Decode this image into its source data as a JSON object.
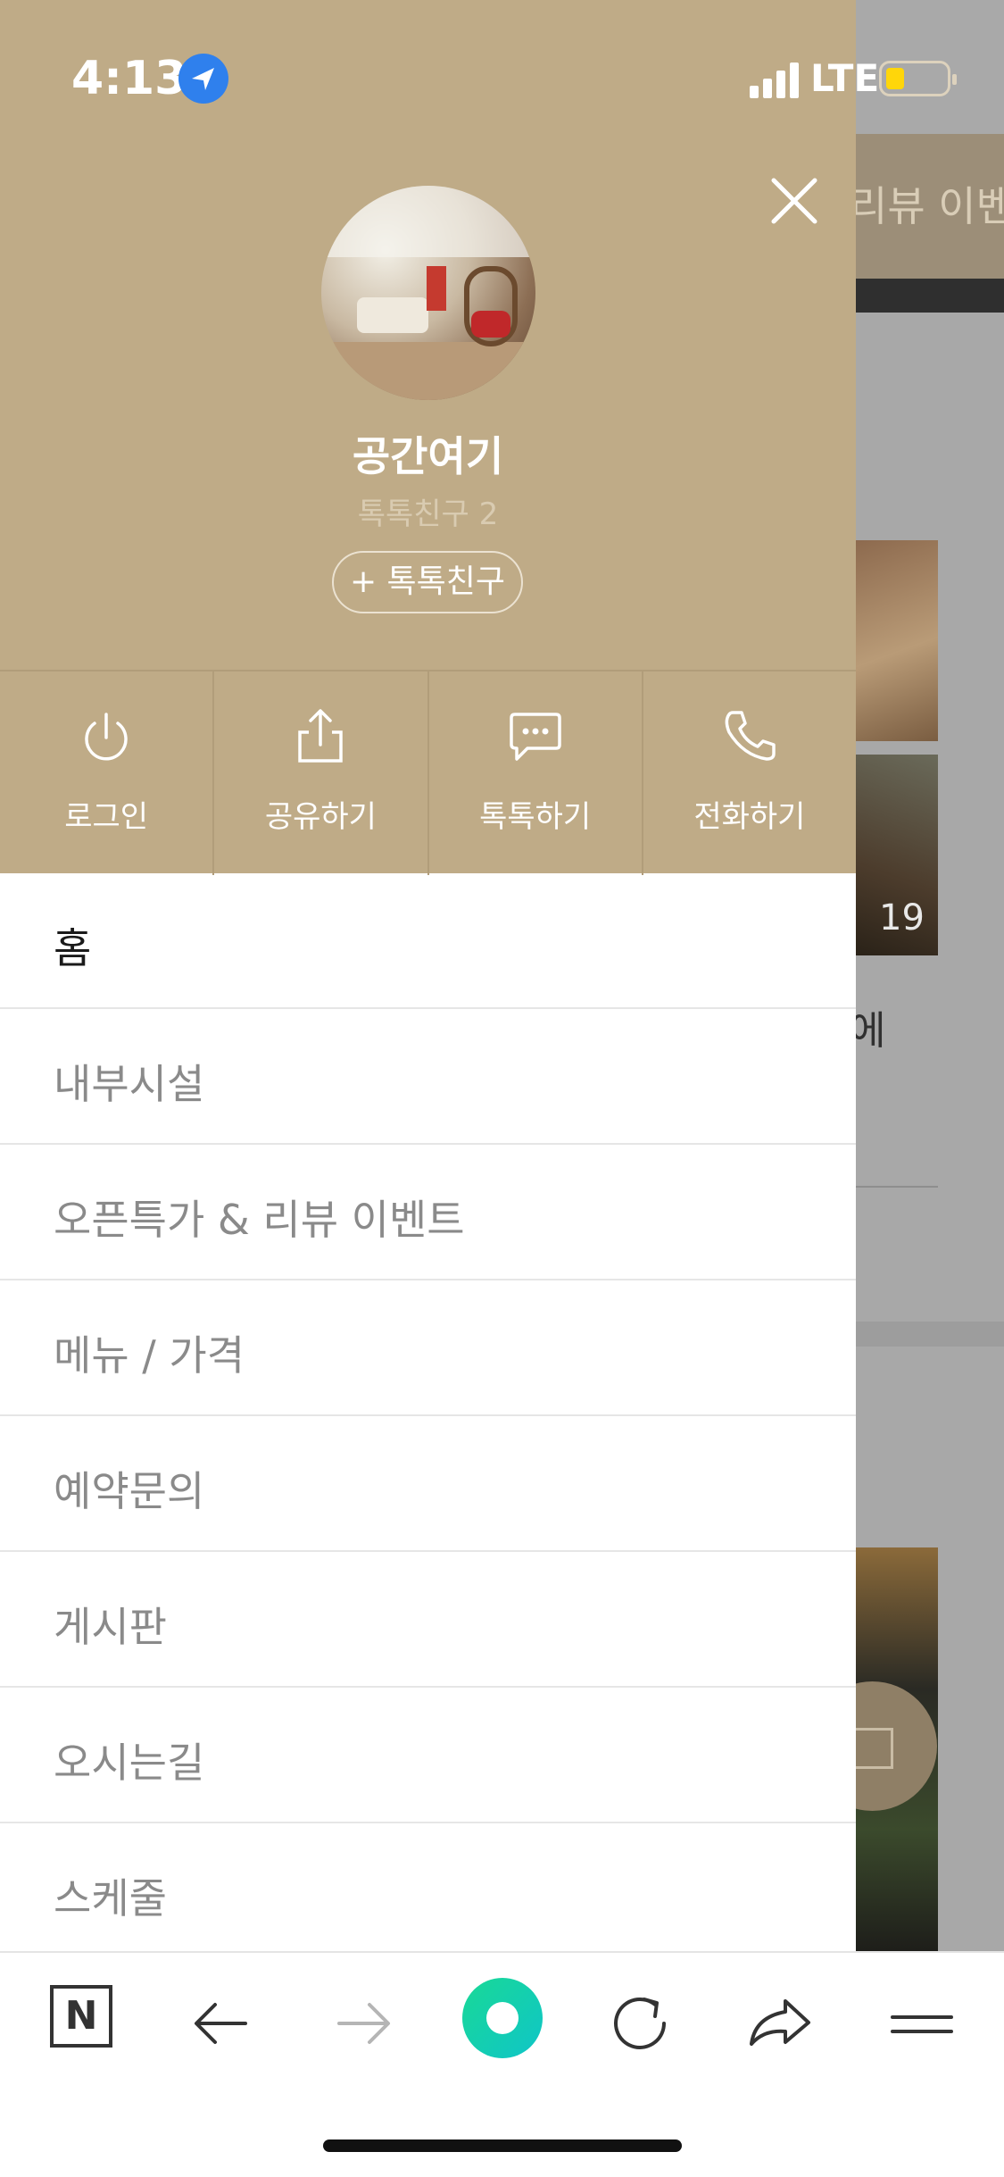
{
  "status": {
    "time": "4:13",
    "network": "LTE"
  },
  "background": {
    "top_text": "리뷰 이벤",
    "count": "19",
    "text": "에"
  },
  "drawer": {
    "profile": {
      "name": "공간여기",
      "friends": "톡톡친구 2",
      "add_friend": "+ 톡톡친구"
    },
    "actions": [
      {
        "label": "로그인",
        "icon": "power-icon"
      },
      {
        "label": "공유하기",
        "icon": "share-icon"
      },
      {
        "label": "톡톡하기",
        "icon": "chat-icon"
      },
      {
        "label": "전화하기",
        "icon": "phone-icon"
      }
    ],
    "menu": [
      {
        "label": "홈",
        "active": true
      },
      {
        "label": "내부시설"
      },
      {
        "label": "오픈특가 & 리뷰 이벤트"
      },
      {
        "label": "메뉴 / 가격"
      },
      {
        "label": "예약문의"
      },
      {
        "label": "게시판"
      },
      {
        "label": "오시는길"
      },
      {
        "label": "스케줄"
      }
    ]
  },
  "toolbar": {
    "n_label": "N"
  },
  "colors": {
    "header": "#bfab87",
    "accent_green": "#19d996",
    "location_blue": "#2f80ed"
  }
}
